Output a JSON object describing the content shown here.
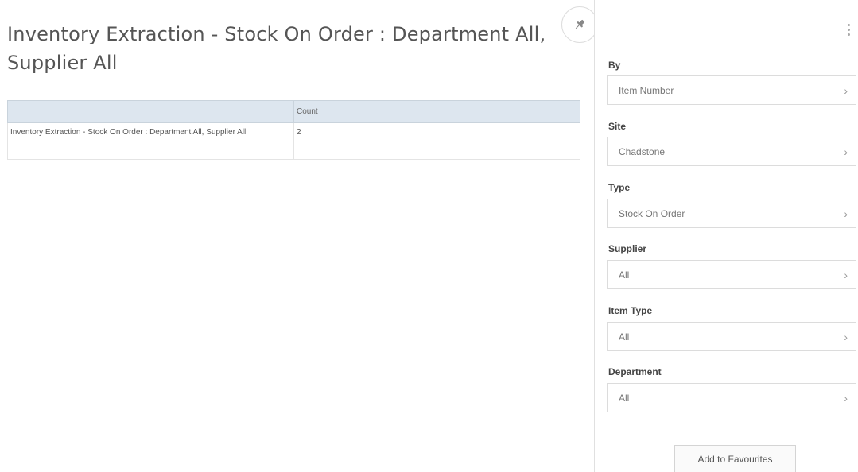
{
  "page": {
    "title": "Inventory Extraction - Stock On Order : Department All, Supplier All"
  },
  "table": {
    "headers": [
      "",
      "Count"
    ],
    "rows": [
      [
        "Inventory Extraction - Stock On Order : Department All, Supplier All",
        "2"
      ]
    ]
  },
  "sidebar": {
    "filters": [
      {
        "label": "By",
        "value": "Item Number"
      },
      {
        "label": "Site",
        "value": "Chadstone"
      },
      {
        "label": "Type",
        "value": "Stock On Order"
      },
      {
        "label": "Supplier",
        "value": "All"
      },
      {
        "label": "Item Type",
        "value": "All"
      },
      {
        "label": "Department",
        "value": "All"
      }
    ],
    "add_favourites_label": "Add to Favourites"
  },
  "icons": {
    "pin": "pin-icon",
    "menu": "kebab-menu-icon",
    "chevron": "chevron-right-icon"
  }
}
